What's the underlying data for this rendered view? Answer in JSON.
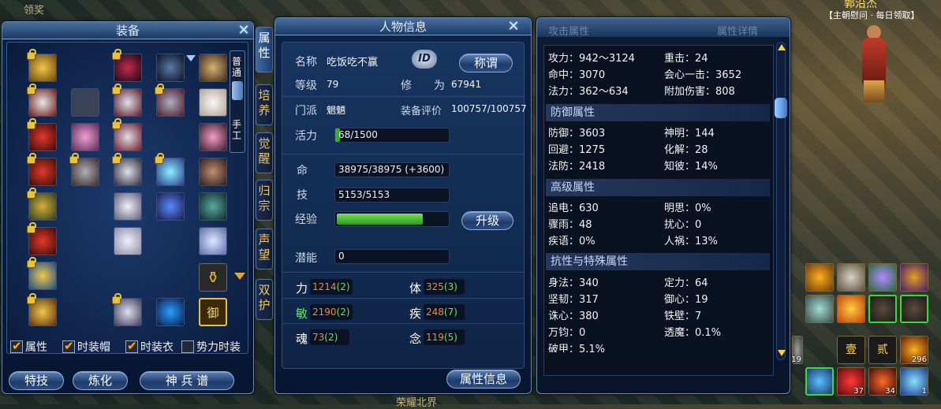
{
  "scene": {
    "npc_name": "郭沿杰",
    "npc_title": "【主朝慰问 · 每日领取】",
    "bottom_text": "荣耀北界",
    "left_fragment": "领奖"
  },
  "equip": {
    "title": "装备",
    "mode_top": "普通",
    "mode_bottom": "手工",
    "checks": [
      {
        "label": "属性",
        "on": true
      },
      {
        "label": "时装帽",
        "on": true
      },
      {
        "label": "时装衣",
        "on": true
      },
      {
        "label": "势力时装",
        "on": false
      }
    ],
    "buttons": {
      "skill": "特技",
      "refine": "炼化",
      "weapon": "神 兵 谱"
    },
    "slot_glyph": "御"
  },
  "tabs": [
    "属性",
    "培养",
    "觉醒",
    "归宗",
    "声望",
    "双护"
  ],
  "char": {
    "title": "人物信息",
    "name_label": "名称",
    "name": "吃饭吃不赢",
    "id_badge": "ID",
    "title_btn": "称谓",
    "level_label": "等级",
    "level": "79",
    "cultivate_label": "修　　为",
    "cultivate": "67941",
    "sect_label": "门派",
    "sect": "魍魉",
    "rating_label": "装备评价",
    "rating": "100757/100757",
    "vitality_label": "活力",
    "vitality": "68/1500",
    "vitality_fraction": 0.045,
    "hp_label": "命",
    "hp": "38975/38975 (+3600)",
    "skill_label": "技",
    "skill": "5153/5153",
    "exp_label": "经验",
    "exp_fraction": 0.78,
    "upgrade_btn": "升级",
    "potential_label": "潜能",
    "potential": "0",
    "stats": [
      {
        "name": "力",
        "base": "1214",
        "bonus": "(2)"
      },
      {
        "name": "体",
        "base": "325",
        "bonus": "(3)"
      },
      {
        "name": "敏",
        "base": "2190",
        "bonus": "(2)",
        "highlight": true
      },
      {
        "name": "疾",
        "base": "248",
        "bonus": "(7)"
      },
      {
        "name": "魂",
        "base": "73",
        "bonus": "(2)"
      },
      {
        "name": "念",
        "base": "119",
        "bonus": "(5)"
      }
    ],
    "attr_btn": "属性信息"
  },
  "attrs": {
    "header": "攻击属性",
    "header2": "属性详情",
    "attack": [
      [
        "攻力：942～3124",
        "重击：24"
      ],
      [
        "命中：3070",
        "会心一击：3652"
      ],
      [
        "法力：362～634",
        "附加伤害：808"
      ]
    ],
    "defense_title": "防御属性",
    "defense": [
      [
        "防御：3603",
        "神明：144"
      ],
      [
        "回避：1275",
        "化解：28"
      ],
      [
        "法防：2418",
        "知彼：14%"
      ]
    ],
    "advanced_title": "高级属性",
    "advanced": [
      [
        "追电：630",
        "明思：0%"
      ],
      [
        "骤雨：48",
        "扰心：0"
      ],
      [
        "疾语：0%",
        "人祸：13%"
      ]
    ],
    "special_title": "抗性与特殊属性",
    "special": [
      [
        "身法：340",
        "定力：64"
      ],
      [
        "坚韧：317",
        "御心：19"
      ],
      [
        "诛心：380",
        "铁壁：7"
      ],
      [
        "万钧：0",
        "透魔：0.1%"
      ],
      [
        "破甲：5.1%",
        ""
      ]
    ]
  },
  "hotbar": {
    "counts": [
      "37",
      "34",
      "1",
      "296",
      "19"
    ],
    "tag1": "壹",
    "tag2": "贰"
  }
}
